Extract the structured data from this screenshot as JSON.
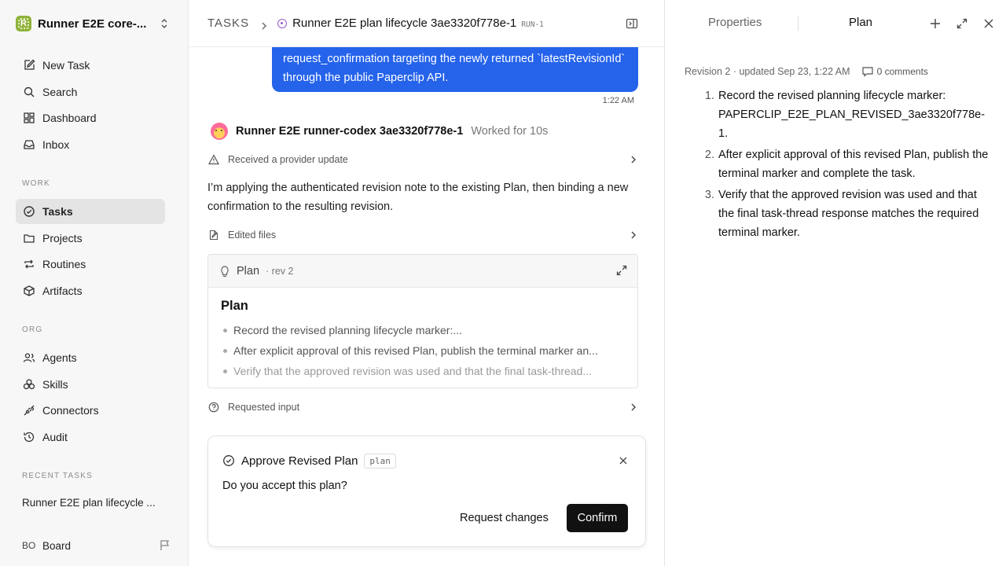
{
  "workspace": {
    "name": "Runner E2E core-...",
    "logo_letter": "R"
  },
  "nav": {
    "primary": [
      {
        "label": "New Task",
        "icon": "edit-icon"
      },
      {
        "label": "Search",
        "icon": "search-icon"
      },
      {
        "label": "Dashboard",
        "icon": "dashboard-icon"
      },
      {
        "label": "Inbox",
        "icon": "inbox-icon"
      }
    ],
    "work_label": "WORK",
    "work": [
      {
        "label": "Tasks",
        "icon": "check-circle-icon",
        "active": true
      },
      {
        "label": "Projects",
        "icon": "folder-icon"
      },
      {
        "label": "Routines",
        "icon": "repeat-icon"
      },
      {
        "label": "Artifacts",
        "icon": "box-icon"
      }
    ],
    "org_label": "ORG",
    "org": [
      {
        "label": "Agents",
        "icon": "users-icon"
      },
      {
        "label": "Skills",
        "icon": "skills-icon"
      },
      {
        "label": "Connectors",
        "icon": "plug-icon"
      },
      {
        "label": "Audit",
        "icon": "history-icon"
      }
    ],
    "recent_label": "RECENT TASKS",
    "recent": [
      "Runner E2E plan lifecycle ..."
    ],
    "board": {
      "avatar": "BO",
      "label": "Board"
    }
  },
  "breadcrumb": {
    "root": "TASKS",
    "title": "Runner E2E plan lifecycle 3ae3320f778e-1",
    "run_id": "RUN-1"
  },
  "thread": {
    "user_message": "request_confirmation targeting the newly returned `latestRevisionId` through the public Paperclip API.",
    "user_time": "1:22 AM",
    "agent_name": "Runner E2E runner-codex 3ae3320f778e-1",
    "agent_worked": "Worked for 10s",
    "event_provider": "Received a provider update",
    "agent_message": "I’m applying the authenticated revision note to the existing Plan, then binding a new confirmation to the resulting revision.",
    "event_edited": "Edited files",
    "event_requested": "Requested input"
  },
  "plan_card": {
    "label": "Plan",
    "rev": "· rev 2",
    "heading": "Plan",
    "bullets": [
      "Record the revised planning lifecycle marker:...",
      "After explicit approval of this revised Plan, publish the terminal marker an...",
      "Verify that the approved revision was used and that the final task-thread..."
    ]
  },
  "confirmation": {
    "title": "Approve Revised Plan",
    "tag": "plan",
    "question": "Do you accept this plan?",
    "request_changes": "Request changes",
    "confirm": "Confirm"
  },
  "right_panel": {
    "tab_properties": "Properties",
    "tab_plan": "Plan",
    "meta": "Revision 2 · updated Sep 23, 1:22 AM",
    "comments": "0 comments",
    "steps": [
      {
        "num": "1.",
        "text": "Record the revised planning lifecycle marker: PAPERCLIP_E2E_PLAN_REVISED_3ae3320f778e-1."
      },
      {
        "num": "2.",
        "text": "After explicit approval of this revised Plan, publish the terminal marker and complete the task."
      },
      {
        "num": "3.",
        "text": "Verify that the approved revision was used and that the final task-thread response matches the required terminal marker."
      }
    ]
  },
  "colors": {
    "accent": "#2563eb",
    "primary_button": "#111111",
    "status_purple": "#9b59d0"
  }
}
